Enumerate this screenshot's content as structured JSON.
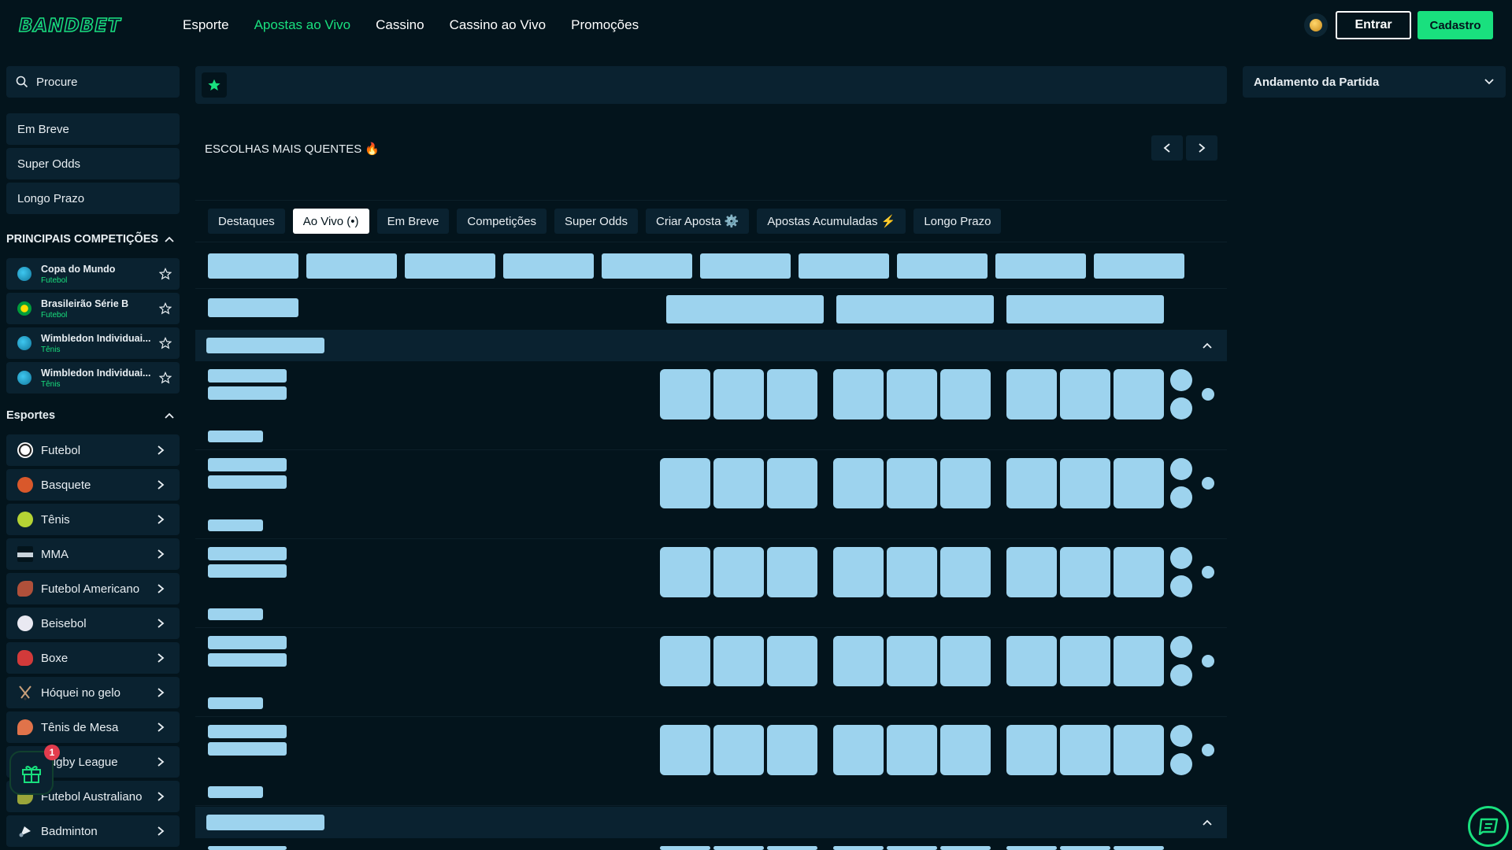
{
  "header": {
    "logo": "BANDBET",
    "nav": [
      "Esporte",
      "Apostas ao Vivo",
      "Cassino",
      "Cassino ao Vivo",
      "Promoções"
    ],
    "active_nav": "Apostas ao Vivo",
    "login_label": "Entrar",
    "signup_label": "Cadastro"
  },
  "sidebar": {
    "search_placeholder": "Procure",
    "quick_links": [
      "Em Breve",
      "Super Odds",
      "Longo Prazo"
    ],
    "competitions_title": "PRINCIPAIS COMPETIÇÕES",
    "competitions": [
      {
        "name": "Copa do Mundo",
        "sport": "Futebol"
      },
      {
        "name": "Brasileirão Série B",
        "sport": "Futebol"
      },
      {
        "name": "Wimbledon Individuai...",
        "sport": "Tênis"
      },
      {
        "name": "Wimbledon Individuai...",
        "sport": "Tênis"
      }
    ],
    "sports_title": "Esportes",
    "sports": [
      "Futebol",
      "Basquete",
      "Tênis",
      "MMA",
      "Futebol Americano",
      "Beisebol",
      "Boxe",
      "Hóquei no gelo",
      "Tênis de Mesa",
      "Rugby League",
      "Futebol Australiano",
      "Badminton"
    ]
  },
  "main": {
    "hot_picks": "ESCOLHAS MAIS QUENTES 🔥",
    "tabs": [
      "Destaques",
      "Ao Vivo (•)",
      "Em Breve",
      "Competições",
      "Super Odds",
      "Criar Aposta ⚙️",
      "Apostas Acumuladas ⚡",
      "Longo Prazo"
    ],
    "active_tab": "Ao Vivo (•)"
  },
  "right_panel": {
    "title": "Andamento da Partida"
  },
  "gift_badge": "1",
  "colors": {
    "accent": "#19e07e",
    "background": "#03141c",
    "panel": "#0a2230",
    "skeleton": "#9dd3ee"
  }
}
